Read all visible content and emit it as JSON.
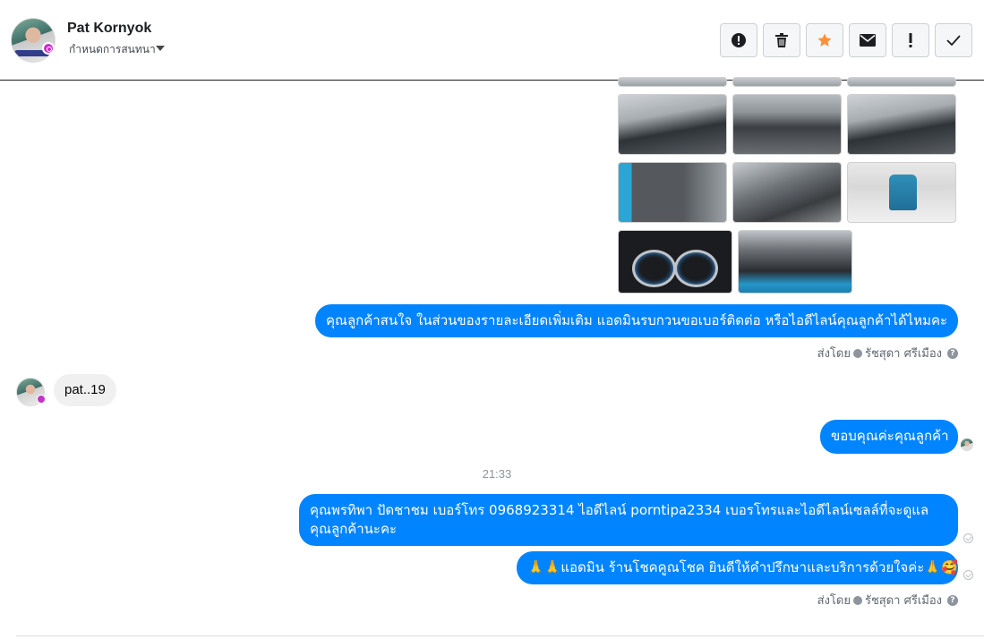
{
  "header": {
    "contact_name": "Pat Kornyok",
    "assign_label": "กำหนดการสนทนา",
    "actions": [
      {
        "name": "report-button",
        "icon": "exclamation-circle-icon"
      },
      {
        "name": "delete-button",
        "icon": "trash-icon"
      },
      {
        "name": "star-button",
        "icon": "star-icon",
        "color": "#f7923a"
      },
      {
        "name": "mark-unread-button",
        "icon": "envelope-icon"
      },
      {
        "name": "important-button",
        "icon": "exclamation-icon"
      },
      {
        "name": "done-button",
        "icon": "check-icon"
      }
    ]
  },
  "messages": {
    "page_msg1": "คุณลูกค้าสนใจ ในส่วนของรายละเอียดเพิ่มเติม แอดมินรบกวนขอเบอร์ติดต่อ หรือไอดีไลน์คุณลูกค้าได้ไหมคะ",
    "sent_by_label": "ส่งโดย",
    "sender_name": "รัชสุดา ศรีเมือง",
    "user_msg": "pat..19",
    "page_msg2": "ขอบคุณค่ะคุณลูกค้า",
    "timestamp": "21:33",
    "page_msg3": "คุณพรทิพา ปัดชาชม      เบอร์โทร 0968923314  ไอดีไลน์ porntipa2334   เบอรโทรและไอดีไลน์เซลล์ที่จะดูแลคุณลูกค้านะคะ",
    "page_msg4": "🙏🙏แอดมิน ร้านโชคคูณโชค ยินดีให้คำปรึกษาและบริการด้วยใจค่ะ🙏🥰",
    "sent_by_label2": "ส่งโดย",
    "sender_name2": "รัชสุดา ศรีเมือง"
  },
  "colors": {
    "outgoing_bubble": "#0084ff",
    "incoming_bubble": "#f1f0f0",
    "accent_star": "#f7923a"
  }
}
